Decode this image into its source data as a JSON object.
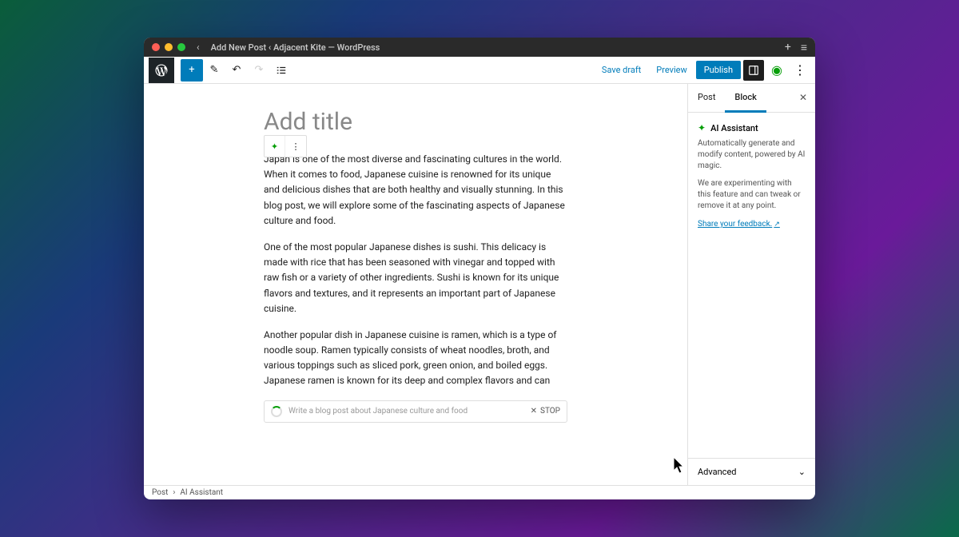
{
  "window": {
    "title": "Add New Post ‹ Adjacent Kite — WordPress"
  },
  "toolbar": {
    "save_draft": "Save draft",
    "preview": "Preview",
    "publish": "Publish"
  },
  "editor": {
    "title_placeholder": "Add title",
    "paragraphs": [
      "Japan is one of the most diverse and fascinating cultures in the world. When it comes to food, Japanese cuisine is renowned for its unique and delicious dishes that are both healthy and visually stunning. In this blog post, we will explore some of the fascinating aspects of Japanese culture and food.",
      "One of the most popular Japanese dishes is sushi. This delicacy is made with rice that has been seasoned with vinegar and topped with raw fish or a variety of other ingredients. Sushi is known for its unique flavors and textures, and it represents an important part of Japanese cuisine.",
      "Another popular dish in Japanese cuisine is ramen, which is a type of noodle soup. Ramen typically consists of wheat noodles, broth, and various toppings such as sliced pork, green onion, and boiled eggs. Japanese ramen is known for its deep and complex flavors and can"
    ],
    "ai_prompt": {
      "placeholder": "Write a blog post about Japanese culture and food",
      "stop": "STOP"
    }
  },
  "sidebar": {
    "tabs": {
      "post": "Post",
      "block": "Block"
    },
    "block": {
      "title": "AI Assistant",
      "description": "Automatically generate and modify content, powered by AI magic.",
      "experiment_note": "We are experimenting with this feature and can tweak or remove it at any point.",
      "feedback": "Share your feedback."
    },
    "advanced": "Advanced"
  },
  "breadcrumb": {
    "root": "Post",
    "current": "AI Assistant"
  }
}
